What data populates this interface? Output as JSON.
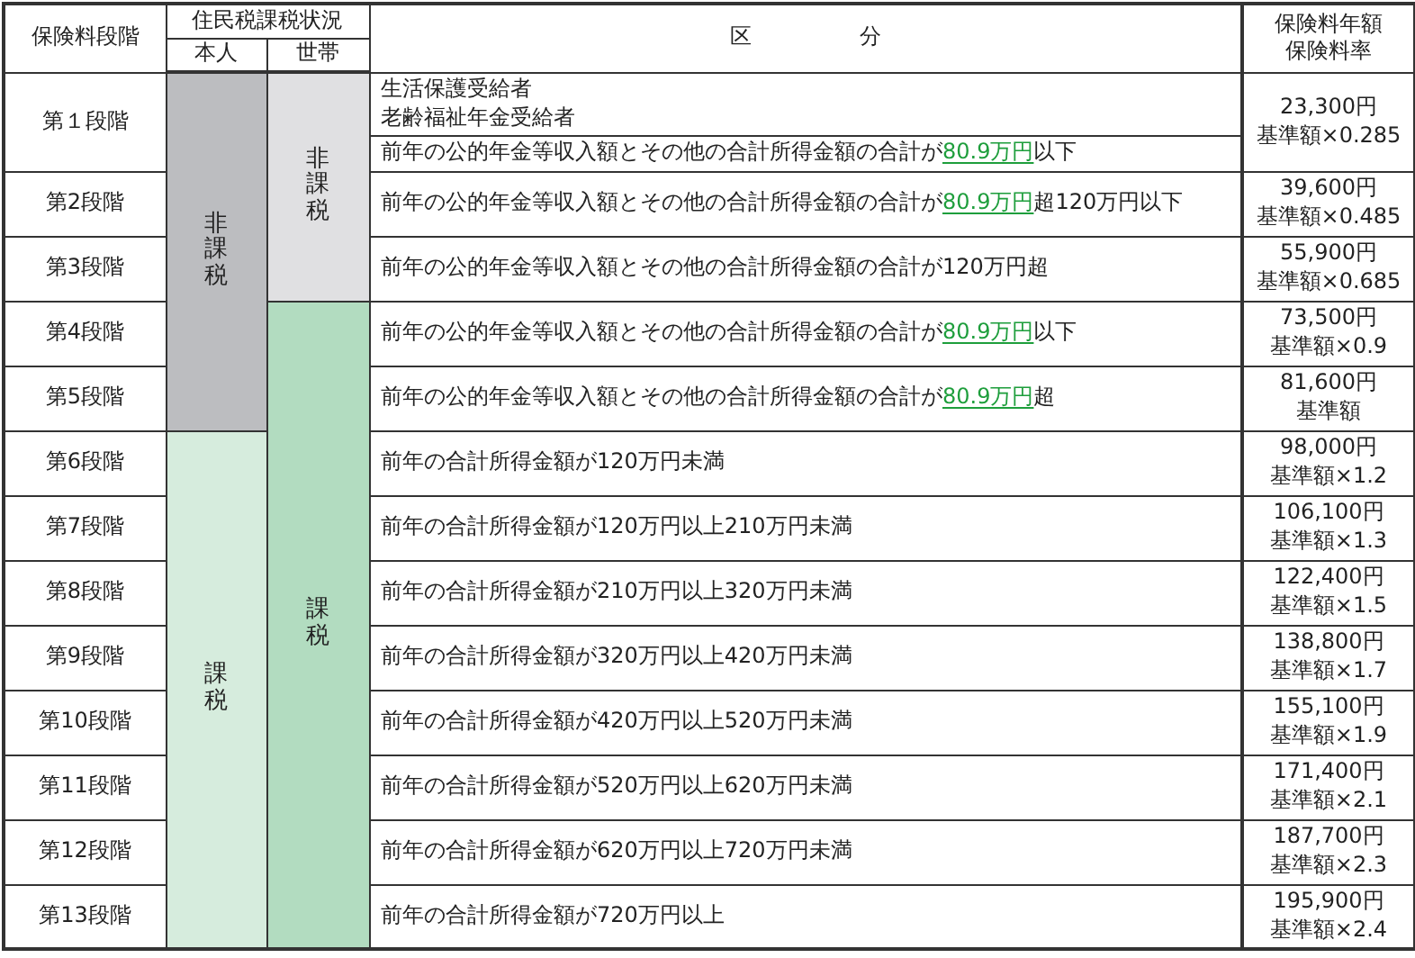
{
  "header": {
    "stage": "保険料段階",
    "tax_status": "住民税課税状況",
    "self": "本人",
    "household": "世帯",
    "category": "区　　　　　分",
    "fee": "保険料年額",
    "rate": "保険料率"
  },
  "self_groups": [
    {
      "kind": "non_taxable",
      "label": "非課税"
    },
    {
      "kind": "taxable",
      "label": "課税"
    }
  ],
  "household_groups": [
    {
      "kind": "non_taxable",
      "label": "非課税"
    },
    {
      "kind": "taxable",
      "label": "課税"
    }
  ],
  "rows": [
    {
      "stage": "第１段階",
      "self_status": {
        "kind": "non_taxable"
      },
      "household_status": {
        "kind": "non_taxable"
      },
      "category_cells": [
        [
          [
            {
              "text": "生活保護受給者",
              "underlined": false
            }
          ],
          [
            {
              "text": "老齢福祉年金受給者",
              "underlined": false
            }
          ]
        ],
        [
          [
            {
              "text": "前年の公的年金等収入額とその他の合計所得金額の合計が",
              "underlined": false
            },
            {
              "text": "80.9万円",
              "underlined": true
            },
            {
              "text": "以下",
              "underlined": false
            }
          ]
        ]
      ],
      "fee": "23,300円",
      "rate": "基準額×0.285"
    },
    {
      "stage": "第2段階",
      "self_status": {
        "kind": "non_taxable"
      },
      "household_status": {
        "kind": "non_taxable"
      },
      "category_cells": [
        [
          [
            {
              "text": "前年の公的年金等収入額とその他の合計所得金額の合計が",
              "underlined": false
            },
            {
              "text": "80.9万円",
              "underlined": true
            },
            {
              "text": "超120万円以下",
              "underlined": false
            }
          ]
        ]
      ],
      "fee": "39,600円",
      "rate": "基準額×0.485"
    },
    {
      "stage": "第3段階",
      "self_status": {
        "kind": "non_taxable"
      },
      "household_status": {
        "kind": "non_taxable"
      },
      "category_cells": [
        [
          [
            {
              "text": "前年の公的年金等収入額とその他の合計所得金額の合計が120万円超",
              "underlined": false
            }
          ]
        ]
      ],
      "fee": "55,900円",
      "rate": "基準額×0.685"
    },
    {
      "stage": "第4段階",
      "self_status": {
        "kind": "non_taxable"
      },
      "household_status": {
        "kind": "taxable"
      },
      "category_cells": [
        [
          [
            {
              "text": "前年の公的年金等収入額とその他の合計所得金額の合計が",
              "underlined": false
            },
            {
              "text": "80.9万円",
              "underlined": true
            },
            {
              "text": "以下",
              "underlined": false
            }
          ]
        ]
      ],
      "fee": "73,500円",
      "rate": "基準額×0.9"
    },
    {
      "stage": "第5段階",
      "self_status": {
        "kind": "non_taxable"
      },
      "household_status": {
        "kind": "taxable"
      },
      "category_cells": [
        [
          [
            {
              "text": "前年の公的年金等収入額とその他の合計所得金額の合計が",
              "underlined": false
            },
            {
              "text": "80.9万円",
              "underlined": true
            },
            {
              "text": "超",
              "underlined": false
            }
          ]
        ]
      ],
      "fee": "81,600円",
      "rate": "基準額"
    },
    {
      "stage": "第6段階",
      "self_status": {
        "kind": "taxable"
      },
      "household_status": {
        "kind": "taxable"
      },
      "category_cells": [
        [
          [
            {
              "text": "前年の合計所得金額が120万円未満",
              "underlined": false
            }
          ]
        ]
      ],
      "fee": "98,000円",
      "rate": "基準額×1.2"
    },
    {
      "stage": "第7段階",
      "self_status": {
        "kind": "taxable"
      },
      "household_status": {
        "kind": "taxable"
      },
      "category_cells": [
        [
          [
            {
              "text": "前年の合計所得金額が120万円以上210万円未満",
              "underlined": false
            }
          ]
        ]
      ],
      "fee": "106,100円",
      "rate": "基準額×1.3"
    },
    {
      "stage": "第8段階",
      "self_status": {
        "kind": "taxable"
      },
      "household_status": {
        "kind": "taxable"
      },
      "category_cells": [
        [
          [
            {
              "text": "前年の合計所得金額が210万円以上320万円未満",
              "underlined": false
            }
          ]
        ]
      ],
      "fee": "122,400円",
      "rate": "基準額×1.5"
    },
    {
      "stage": "第9段階",
      "self_status": {
        "kind": "taxable"
      },
      "household_status": {
        "kind": "taxable"
      },
      "category_cells": [
        [
          [
            {
              "text": "前年の合計所得金額が320万円以上420万円未満",
              "underlined": false
            }
          ]
        ]
      ],
      "fee": "138,800円",
      "rate": "基準額×1.7"
    },
    {
      "stage": "第10段階",
      "self_status": {
        "kind": "taxable"
      },
      "household_status": {
        "kind": "taxable"
      },
      "category_cells": [
        [
          [
            {
              "text": "前年の合計所得金額が420万円以上520万円未満",
              "underlined": false
            }
          ]
        ]
      ],
      "fee": "155,100円",
      "rate": "基準額×1.9"
    },
    {
      "stage": "第11段階",
      "self_status": {
        "kind": "taxable"
      },
      "household_status": {
        "kind": "taxable"
      },
      "category_cells": [
        [
          [
            {
              "text": "前年の合計所得金額が520万円以上620万円未満",
              "underlined": false
            }
          ]
        ]
      ],
      "fee": "171,400円",
      "rate": "基準額×2.1"
    },
    {
      "stage": "第12段階",
      "self_status": {
        "kind": "taxable"
      },
      "household_status": {
        "kind": "taxable"
      },
      "category_cells": [
        [
          [
            {
              "text": "前年の合計所得金額が620万円以上720万円未満",
              "underlined": false
            }
          ]
        ]
      ],
      "fee": "187,700円",
      "rate": "基準額×2.3"
    },
    {
      "stage": "第13段階",
      "self_status": {
        "kind": "taxable"
      },
      "household_status": {
        "kind": "taxable"
      },
      "category_cells": [
        [
          [
            {
              "text": "前年の合計所得金額が720万円以上",
              "underlined": false
            }
          ]
        ]
      ],
      "fee": "195,900円",
      "rate": "基準額×2.4"
    }
  ]
}
